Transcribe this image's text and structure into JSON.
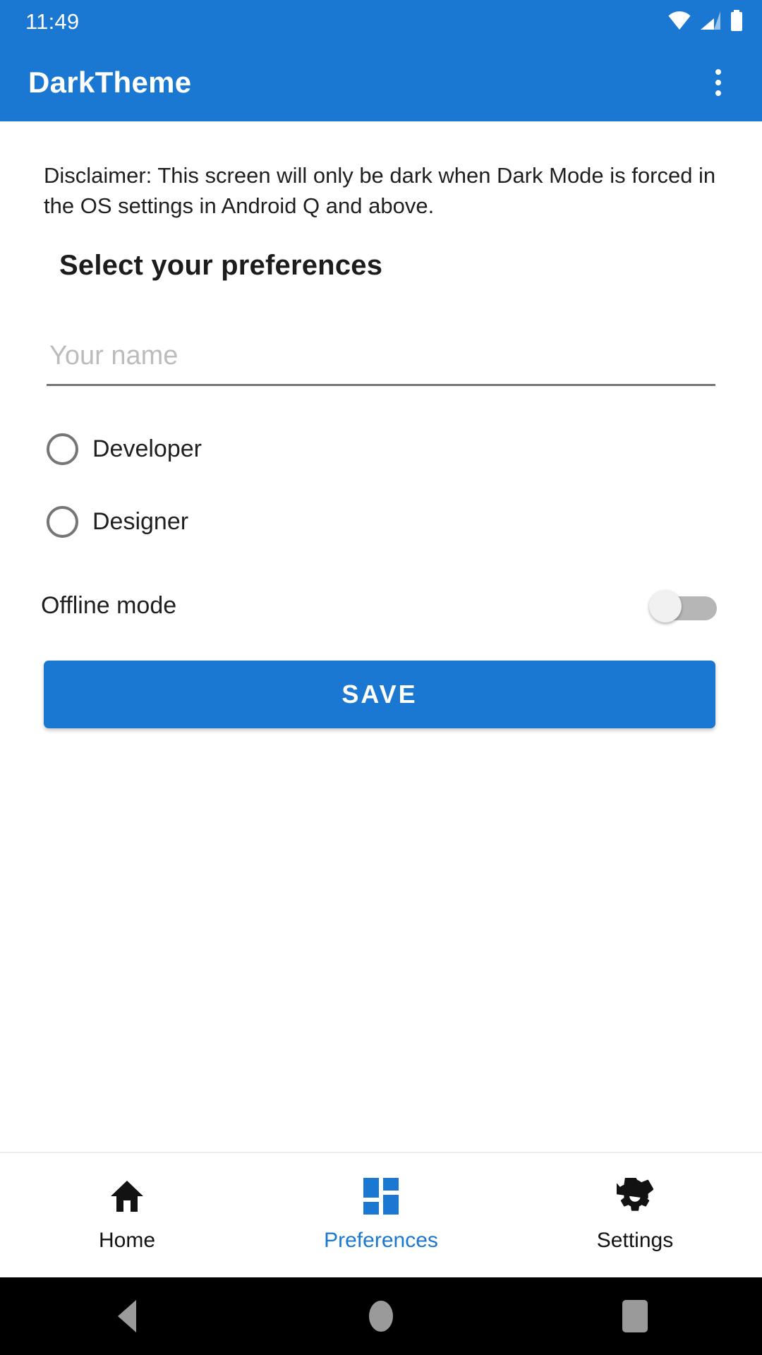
{
  "status_bar": {
    "time": "11:49",
    "icons": [
      "wifi-icon",
      "cellular-signal-icon",
      "battery-icon"
    ]
  },
  "app_bar": {
    "title": "DarkTheme",
    "overflow_menu": "overflow-menu-icon",
    "background_color": "#1a78d2"
  },
  "main": {
    "disclaimer": "Disclaimer: This screen will only be dark when Dark Mode is forced in the OS settings in Android Q and above.",
    "section_title": "Select your preferences",
    "name_field": {
      "value": "",
      "placeholder": "Your name"
    },
    "radios": [
      {
        "label": "Developer",
        "selected": false
      },
      {
        "label": "Designer",
        "selected": false
      }
    ],
    "toggle": {
      "label": "Offline mode",
      "checked": false
    },
    "save_label": "SAVE",
    "accent_color": "#1a78d2"
  },
  "bottom_nav": {
    "items": [
      {
        "label": "Home",
        "icon": "home-icon",
        "active": false
      },
      {
        "label": "Preferences",
        "icon": "dashboard-icon",
        "active": true
      },
      {
        "label": "Settings",
        "icon": "gear-icon",
        "active": false
      }
    ],
    "active_color": "#1a78d2"
  },
  "android_nav": {
    "back": "back-icon",
    "home": "home-circle-icon",
    "recents": "recents-icon"
  }
}
